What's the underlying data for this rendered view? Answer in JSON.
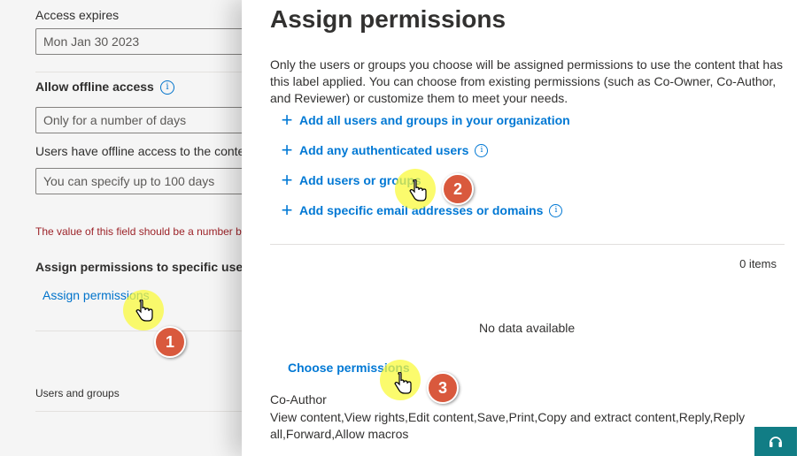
{
  "background_form": {
    "access_expires_label": "Access expires",
    "access_expires_value": "Mon Jan 30 2023",
    "offline_label": "Allow offline access",
    "offline_info_icon": "info-icon",
    "offline_select_value": "Only for a number of days",
    "offline_days_label": "Users have offline access to the content",
    "offline_days_placeholder": "You can specify up to 100 days",
    "error_text": "The value of this field should be a number between",
    "assign_section_label": "Assign permissions to specific users",
    "assign_link": "Assign permissions",
    "users_groups_label": "Users and groups"
  },
  "panel": {
    "title": "Assign permissions",
    "description": "Only the users or groups you choose will be assigned permissions to use the content that has this label applied. You can choose from existing permissions (such as Co-Owner, Co-Author, and Reviewer) or customize them to meet your needs.",
    "add_actions": [
      {
        "label": "Add all users and groups in your organization",
        "icon": "plus-icon",
        "info": false
      },
      {
        "label": "Add any authenticated users",
        "icon": "plus-icon",
        "info": true
      },
      {
        "label": "Add users or groups",
        "icon": "plus-icon",
        "info": false
      },
      {
        "label": "Add specific email addresses or domains",
        "icon": "plus-icon",
        "info": true
      }
    ],
    "items_count": "0 items",
    "no_data": "No data available",
    "choose_permissions": "Choose permissions",
    "role_name": "Co-Author",
    "role_permissions": "View content,View rights,Edit content,Save,Print,Copy and extract content,Reply,Reply all,Forward,Allow macros"
  },
  "help_button_icon": "headset-icon",
  "annotations": {
    "step1": "1",
    "step2": "2",
    "step3": "3",
    "highlight_color": "#f9f93c",
    "step_color": "#d9593d"
  }
}
